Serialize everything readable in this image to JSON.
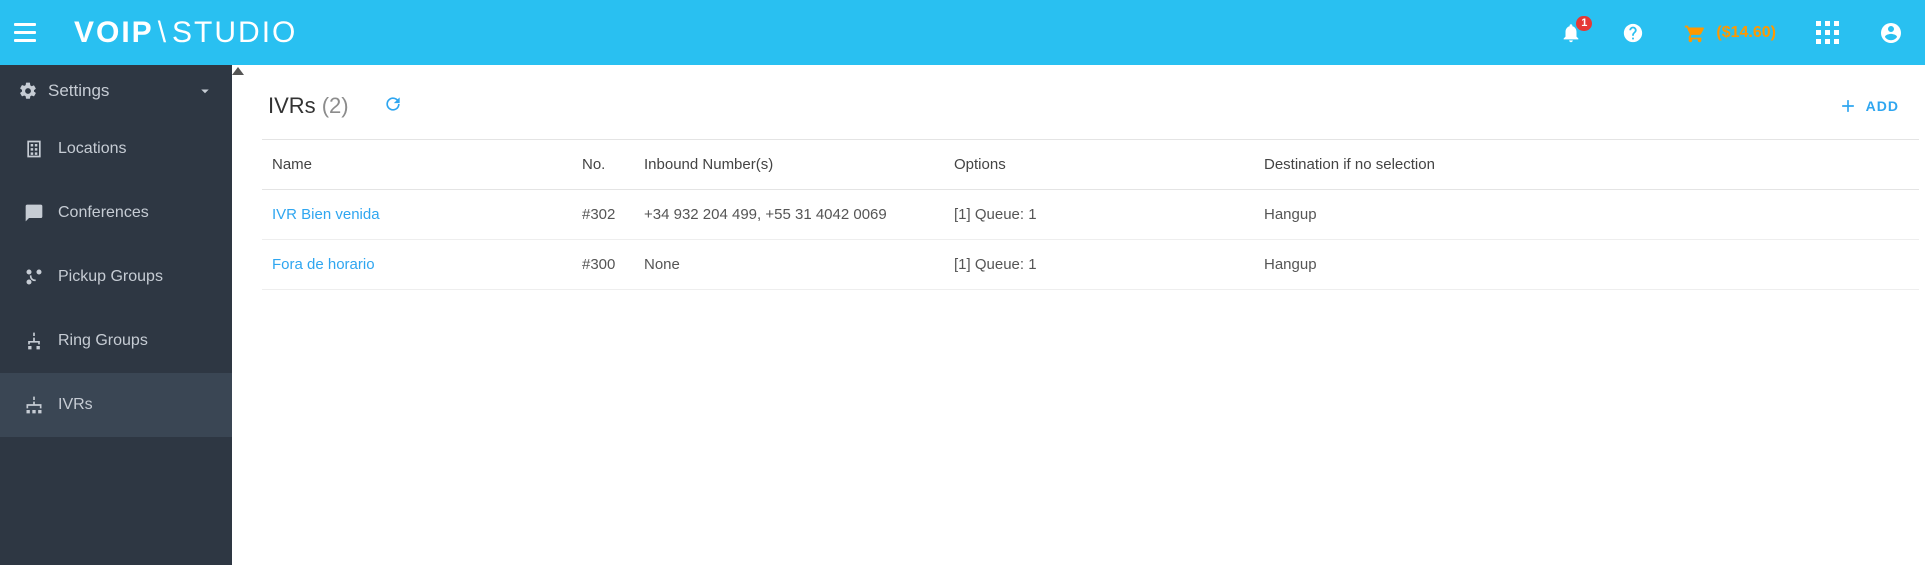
{
  "brand": {
    "left": "VOIP",
    "right": "STUDIO"
  },
  "topbar": {
    "notification_count": "1",
    "balance": "($14.60)"
  },
  "sidebar": {
    "settings_label": "Settings",
    "items": [
      {
        "label": "Locations"
      },
      {
        "label": "Conferences"
      },
      {
        "label": "Pickup Groups"
      },
      {
        "label": "Ring Groups"
      },
      {
        "label": "IVRs"
      }
    ]
  },
  "page": {
    "title": "IVRs",
    "count": "(2)",
    "add_label": "ADD",
    "columns": {
      "name": "Name",
      "no": "No.",
      "inbound": "Inbound Number(s)",
      "options": "Options",
      "destination": "Destination if no selection"
    },
    "rows": [
      {
        "name": "IVR Bien venida",
        "no": "#302",
        "inbound": "+34 932 204 499, +55 31 4042 0069",
        "options": "[1] Queue: 1",
        "destination": "Hangup"
      },
      {
        "name": "Fora de horario",
        "no": "#300",
        "inbound": "None",
        "options": "[1] Queue: 1",
        "destination": "Hangup"
      }
    ]
  }
}
